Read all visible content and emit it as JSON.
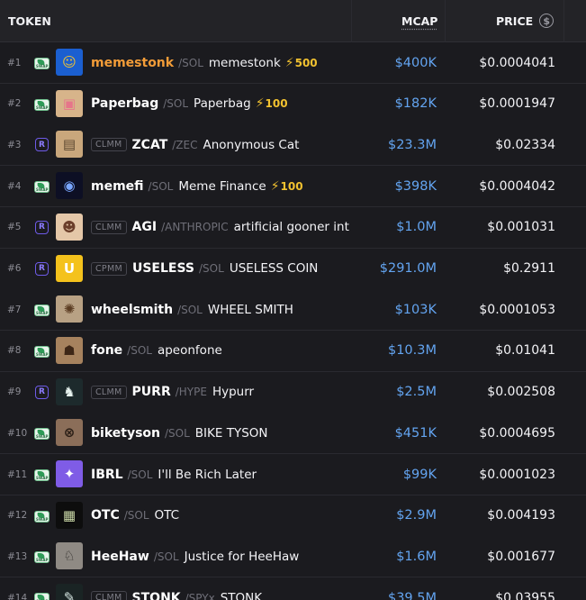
{
  "header": {
    "token": "TOKEN",
    "mcap": "MCAP",
    "price": "PRICE",
    "currency_icon": "$"
  },
  "rows": [
    {
      "rank": "#1",
      "venue": "swap",
      "pool": "",
      "symbol": "memestonk",
      "symbol_highlight": true,
      "chain": "/SOL",
      "name": "memestonk",
      "boost": "500",
      "mcap": "$400K",
      "price": "$0.0004041",
      "avatar_bg": "#1b5fd0",
      "avatar_fg": "#f2c230",
      "avatar_glyph": "☺"
    },
    {
      "rank": "#2",
      "venue": "swap",
      "pool": "",
      "symbol": "Paperbag",
      "chain": "/SOL",
      "name": "Paperbag",
      "boost": "100",
      "mcap": "$182K",
      "price": "$0.0001947",
      "avatar_bg": "#d7b48a",
      "avatar_fg": "#e6758a",
      "avatar_glyph": "▣"
    },
    {
      "rank": "#3",
      "venue": "raydium",
      "pool": "CLMM",
      "symbol": "ZCAT",
      "chain": "/ZEC",
      "name": "Anonymous Cat",
      "boost": "",
      "mcap": "$23.3M",
      "price": "$0.02334",
      "avatar_bg": "#c9a77c",
      "avatar_fg": "#5a4630",
      "avatar_glyph": "▤"
    },
    {
      "rank": "#4",
      "venue": "swap",
      "pool": "",
      "symbol": "memefi",
      "chain": "/SOL",
      "name": "Meme Finance",
      "boost": "100",
      "mcap": "$398K",
      "price": "$0.0004042",
      "avatar_bg": "#0d0f24",
      "avatar_fg": "#7aa6ff",
      "avatar_glyph": "◉"
    },
    {
      "rank": "#5",
      "venue": "raydium",
      "pool": "CLMM",
      "symbol": "AGI",
      "chain": "/ANTHROPIC",
      "name": "artificial gooner int",
      "boost": "",
      "mcap": "$1.0M",
      "price": "$0.001031",
      "avatar_bg": "#e4c7a8",
      "avatar_fg": "#6b3e2a",
      "avatar_glyph": "☻"
    },
    {
      "rank": "#6",
      "venue": "raydium",
      "pool": "CPMM",
      "symbol": "USELESS",
      "chain": "/SOL",
      "name": "USELESS COIN",
      "boost": "",
      "mcap": "$291.0M",
      "price": "$0.2911",
      "avatar_bg": "#f4c21c",
      "avatar_fg": "#ffffff",
      "avatar_glyph": "U"
    },
    {
      "rank": "#7",
      "venue": "swap",
      "pool": "",
      "symbol": "wheelsmith",
      "chain": "/SOL",
      "name": "WHEEL SMITH",
      "boost": "",
      "mcap": "$103K",
      "price": "$0.0001053",
      "avatar_bg": "#b8a184",
      "avatar_fg": "#5b3c22",
      "avatar_glyph": "✺"
    },
    {
      "rank": "#8",
      "venue": "swap",
      "pool": "",
      "symbol": "fone",
      "chain": "/SOL",
      "name": "apeonfone",
      "boost": "",
      "mcap": "$10.3M",
      "price": "$0.01041",
      "avatar_bg": "#a6825e",
      "avatar_fg": "#3d2616",
      "avatar_glyph": "☗"
    },
    {
      "rank": "#9",
      "venue": "raydium",
      "pool": "CLMM",
      "symbol": "PURR",
      "chain": "/HYPE",
      "name": "Hypurr",
      "boost": "",
      "mcap": "$2.5M",
      "price": "$0.002508",
      "avatar_bg": "#1d2a2c",
      "avatar_fg": "#e6f2ee",
      "avatar_glyph": "♞"
    },
    {
      "rank": "#10",
      "venue": "swap",
      "pool": "",
      "symbol": "biketyson",
      "chain": "/SOL",
      "name": "BIKE TYSON",
      "boost": "",
      "mcap": "$451K",
      "price": "$0.0004695",
      "avatar_bg": "#8b6e59",
      "avatar_fg": "#2a1e16",
      "avatar_glyph": "⊗"
    },
    {
      "rank": "#11",
      "venue": "swap",
      "pool": "",
      "symbol": "IBRL",
      "chain": "/SOL",
      "name": "I'll Be Rich Later",
      "boost": "",
      "mcap": "$99K",
      "price": "$0.0001023",
      "avatar_bg": "#7f5ce6",
      "avatar_fg": "#ffffff",
      "avatar_glyph": "✦"
    },
    {
      "rank": "#12",
      "venue": "swap",
      "pool": "",
      "symbol": "OTC",
      "chain": "/SOL",
      "name": "OTC",
      "boost": "",
      "mcap": "$2.9M",
      "price": "$0.004193",
      "avatar_bg": "#0d0d0d",
      "avatar_fg": "#c9d7a6",
      "avatar_glyph": "▦"
    },
    {
      "rank": "#13",
      "venue": "swap",
      "pool": "",
      "symbol": "HeeHaw",
      "chain": "/SOL",
      "name": "Justice for HeeHaw",
      "boost": "",
      "mcap": "$1.6M",
      "price": "$0.001677",
      "avatar_bg": "#8f8a84",
      "avatar_fg": "#2c2a28",
      "avatar_glyph": "♘"
    },
    {
      "rank": "#14",
      "venue": "swap",
      "pool": "CLMM",
      "symbol": "STONK",
      "chain": "/SPYx",
      "name": "STONK",
      "boost": "",
      "mcap": "$39.5M",
      "price": "$0.03955",
      "avatar_bg": "#1a2424",
      "avatar_fg": "#d6e6e2",
      "avatar_glyph": "✎"
    }
  ]
}
